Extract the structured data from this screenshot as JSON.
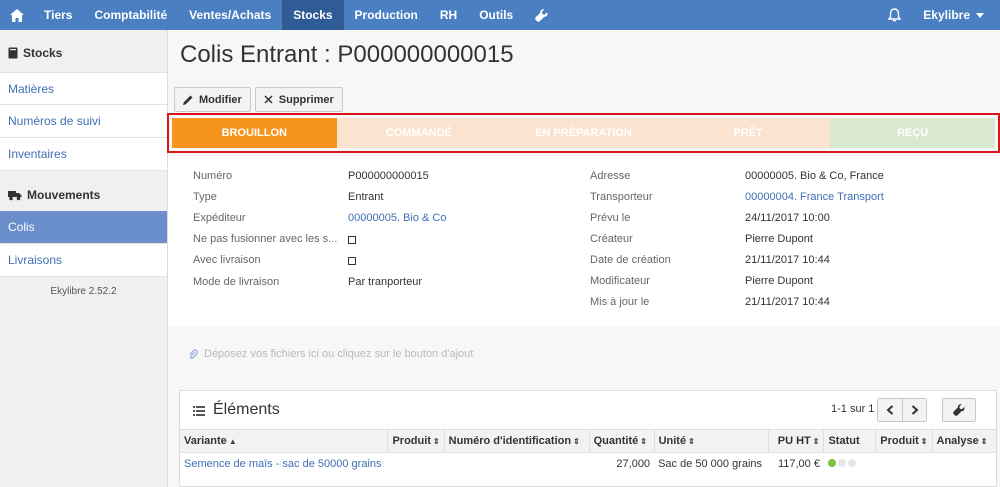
{
  "nav": {
    "items": [
      "Tiers",
      "Comptabilité",
      "Ventes/Achats",
      "Stocks",
      "Production",
      "RH",
      "Outils"
    ],
    "active": "Stocks",
    "user": "Ekylibre",
    "accent": "#4a7fc1"
  },
  "sidebar": {
    "stocks_title": "Stocks",
    "stocks_items": [
      "Matières",
      "Numéros de suivi",
      "Inventaires"
    ],
    "mouvements_title": "Mouvements",
    "mouvements_items": [
      "Colis",
      "Livraisons"
    ],
    "active_item": "Colis",
    "version": "Ekylibre 2.52.2"
  },
  "page": {
    "title": "Colis Entrant : P000000000015",
    "buttons": {
      "edit": "Modifier",
      "delete": "Supprimer"
    }
  },
  "states": [
    {
      "label": "BROUILLON",
      "bg": "#f7941d",
      "active": true
    },
    {
      "label": "COMMANDÉ",
      "bg": "#fbe3cf"
    },
    {
      "label": "EN PRÉPARATION",
      "bg": "#fbe3cf"
    },
    {
      "label": "PRÊT",
      "bg": "#fbe3cf"
    },
    {
      "label": "REÇU",
      "bg": "#d8e9cf"
    }
  ],
  "details": {
    "left": [
      {
        "label": "Numéro",
        "value": "P000000000015"
      },
      {
        "label": "Type",
        "value": "Entrant"
      },
      {
        "label": "Expéditeur",
        "value": "00000005. Bio & Co",
        "link": true
      },
      {
        "label": "Ne pas fusionner avec les s...",
        "value": "",
        "checkbox": true
      },
      {
        "label": "Avec livraison",
        "value": "",
        "checkbox": true
      },
      {
        "label": "Mode de livraison",
        "value": "Par tranporteur"
      }
    ],
    "right": [
      {
        "label": "Adresse",
        "value": "00000005. Bio & Co, France"
      },
      {
        "label": "Transporteur",
        "value": "00000004. France Transport",
        "link": true
      },
      {
        "label": "Prévu le",
        "value": "24/11/2017 10:00"
      },
      {
        "label": "Créateur",
        "value": "Pierre Dupont"
      },
      {
        "label": "Date de création",
        "value": "21/11/2017 10:44"
      },
      {
        "label": "Modificateur",
        "value": "Pierre Dupont"
      },
      {
        "label": "Mis à jour le",
        "value": "21/11/2017 10:44"
      }
    ]
  },
  "dropzone": "Déposez vos fichiers ici ou cliquez sur le bouton d'ajout",
  "elements": {
    "title": "Éléments",
    "pager": "1-1 sur 1",
    "columns": [
      "Variante",
      "Produit",
      "Numéro d'identification",
      "Quantité",
      "Unité",
      "PU HT",
      "Statut",
      "Produit",
      "Analyse"
    ],
    "rows": [
      {
        "variante": "Semence de maïs - sac de 50000 grains",
        "produit": "",
        "numero": "",
        "quantite": "27,000",
        "unite": "Sac de 50 000 grains",
        "pu_ht": "117,00 €",
        "statut": "go",
        "produit2": "",
        "analyse": ""
      }
    ]
  }
}
